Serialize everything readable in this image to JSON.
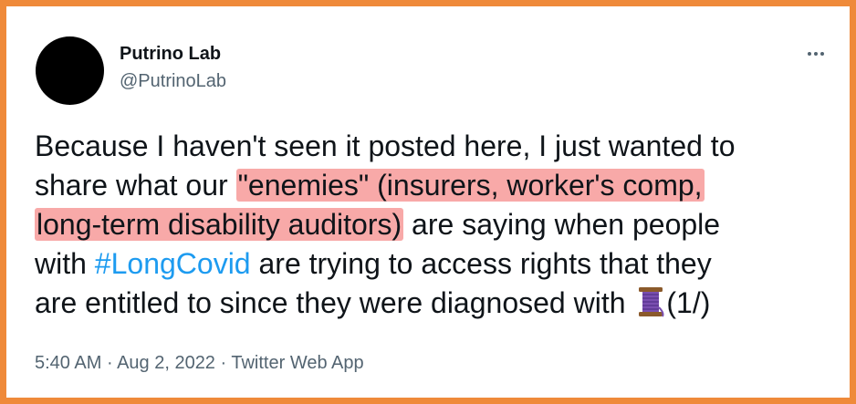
{
  "tweet": {
    "author_name": "Putrino Lab",
    "author_handle": "@PutrinoLab",
    "lines": [
      {
        "plain": "Because I haven't seen it posted here, I just wanted to"
      },
      {
        "pre": "share what our ",
        "highlight": "\"enemies\" (insurers, worker's comp,"
      },
      {
        "highlight": "long-term disability auditors)",
        "post": " are saying when people"
      },
      {
        "pre": "with ",
        "hashtag": "#LongCovid",
        "post": " are trying to access rights that they"
      },
      {
        "pre": "are entitled to since they were diagnosed with ",
        "post": "(1/)"
      }
    ],
    "emoji": "thread-spool-icon",
    "time": "5:40 AM",
    "date": "Aug 2, 2022",
    "source": "Twitter Web App",
    "separator": " · "
  },
  "colors": {
    "frame": "#ef8a3a",
    "highlight": "#f8a9a8",
    "hashtag": "#1d9bf0",
    "muted": "#536471",
    "text": "#0f1419"
  }
}
